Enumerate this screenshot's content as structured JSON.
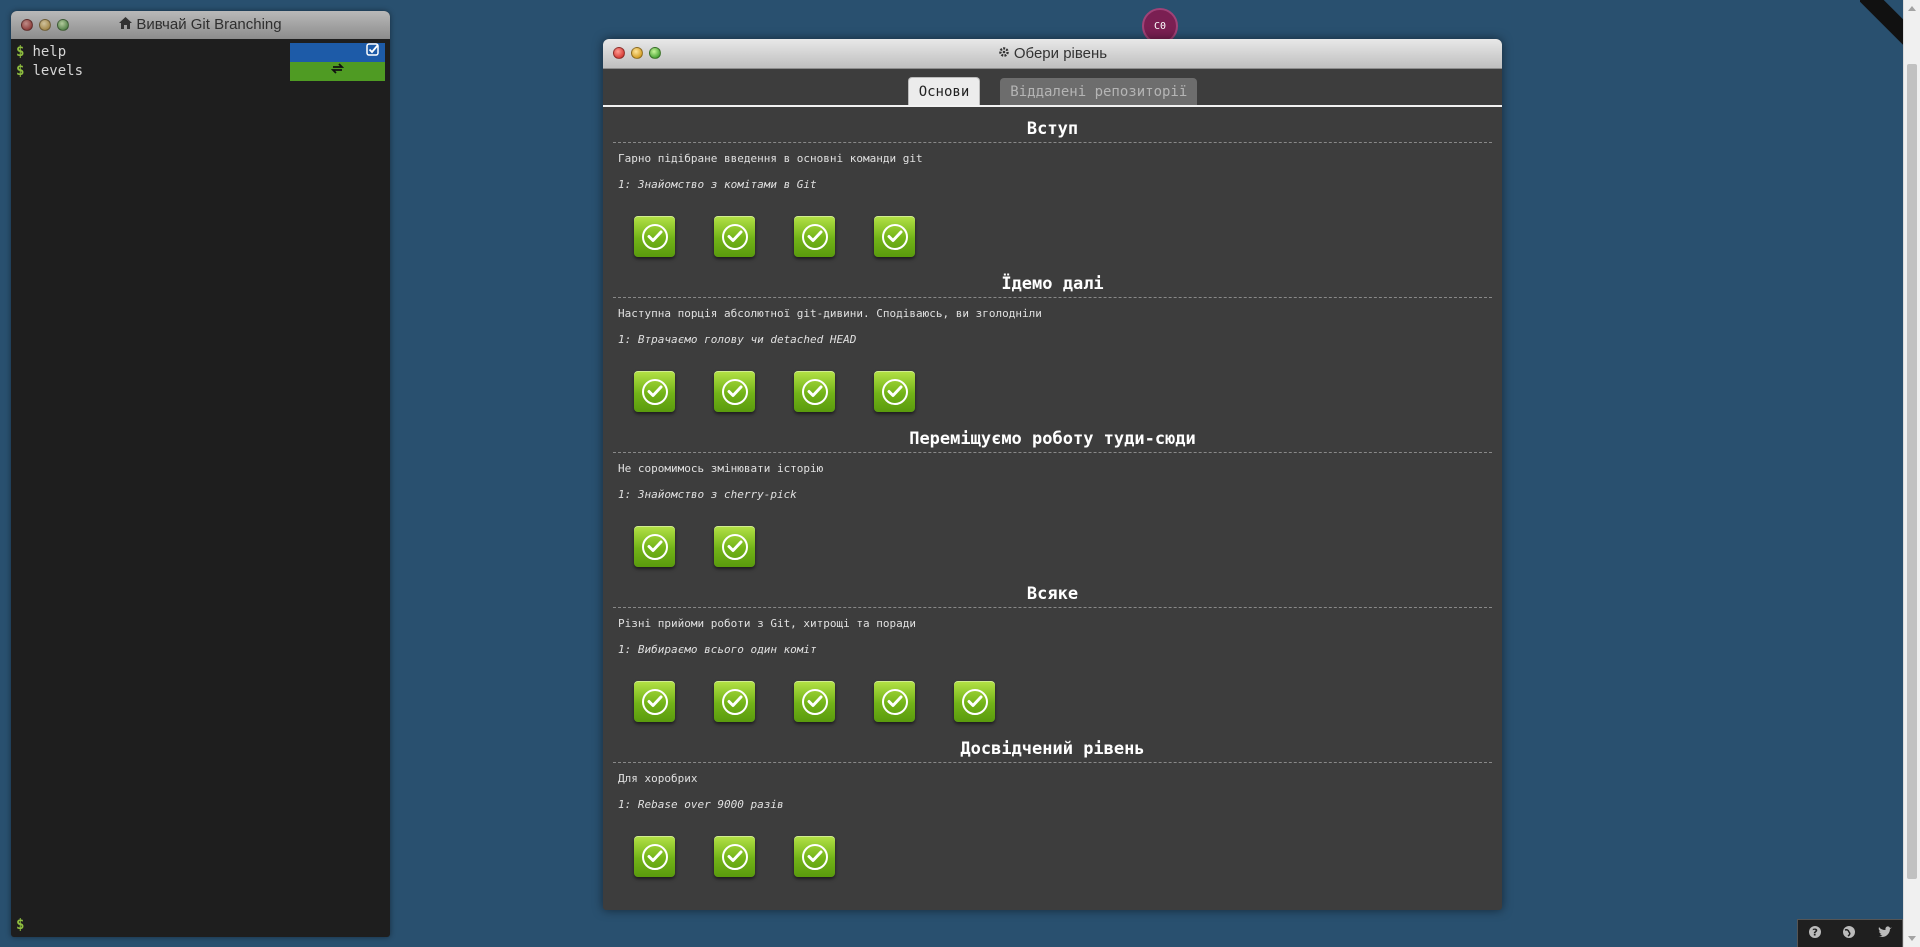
{
  "terminal": {
    "title": "Вивчай Git Branching",
    "title_icon": "home-icon",
    "lines": [
      {
        "prompt": "$",
        "command": "help",
        "status": "finished",
        "status_icon": "check-square-icon"
      },
      {
        "prompt": "$",
        "command": "levels",
        "status": "running",
        "status_icon": "refresh-icon"
      }
    ],
    "current_prompt": "$"
  },
  "avatar": {
    "initials": "C0"
  },
  "dialog": {
    "title": "Обери рівень",
    "title_icon": "gear-icon",
    "tabs": [
      {
        "label": "Основи",
        "active": true
      },
      {
        "label": "Віддалені репозиторії",
        "active": false
      }
    ],
    "sequences": [
      {
        "title": "Вступ",
        "description": "Гарно підібране введення в основні команди git",
        "level_name": "1: Знайомство з комітами в Git",
        "levels_completed": 4
      },
      {
        "title": "Їдемо далі",
        "description": "Наступна порція абсолютної git-дивини. Сподіваюсь, ви зголодніли",
        "level_name": "1: Втрачаємо голову чи detached HEAD",
        "levels_completed": 4
      },
      {
        "title": "Переміщуємо роботу туди-сюди",
        "description": "Не соромимось змінювати історію",
        "level_name": "1: Знайомство з cherry-pick",
        "levels_completed": 2
      },
      {
        "title": "Всяке",
        "description": "Різні прийоми роботи з Git, хитрощі та поради",
        "level_name": "1: Вибираємо всього один коміт",
        "levels_completed": 5
      },
      {
        "title": "Досвідчений рівень",
        "description": "Для хоробрих",
        "level_name": "1: Rebase over 9000 разів",
        "levels_completed": 3
      }
    ]
  },
  "footer": {
    "icons": [
      "help-icon",
      "globe-icon",
      "twitter-icon"
    ]
  },
  "colors": {
    "background": "#29506f",
    "dialog": "#3d3d3d",
    "level_complete": "#72b318",
    "status_finished": "#1d5ba8",
    "status_running": "#4f9b23"
  }
}
